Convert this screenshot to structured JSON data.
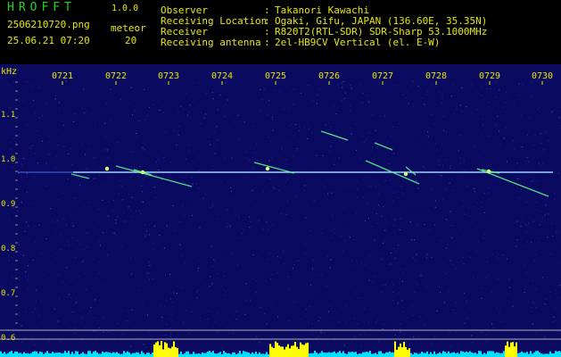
{
  "header": {
    "app_name": "HROFFT",
    "version": "1.0.0",
    "filename": "2506210720.png",
    "timestamp": "25.06.21 07:20",
    "meteor_label": "meteor",
    "meteor_count": "20",
    "info": [
      {
        "label": "Observer",
        "value": "Takanori Kawachi"
      },
      {
        "label": "Receiving Location",
        "value": "Ogaki, Gifu, JAPAN (136.60E, 35.35N)"
      },
      {
        "label": "Receiver",
        "value": "R820T2(RTL-SDR) SDR-Sharp 53.1000MHz"
      },
      {
        "label": "Receiving antenna",
        "value": "2el-HB9CV Vertical (el. E-W)"
      }
    ]
  },
  "axis": {
    "unit": "kHz",
    "time_ticks": [
      "0721",
      "0722",
      "0723",
      "0724",
      "0725",
      "0726",
      "0727",
      "0728",
      "0729",
      "0730"
    ],
    "freq_ticks": [
      "1.1",
      "1.0",
      "0.9",
      "0.8",
      "0.7",
      "0.6"
    ]
  },
  "colors": {
    "background": "#0a0a60",
    "text": "#e8e800",
    "logo": "#1fd61f",
    "carrier": "#9fd0ff",
    "trace": "#60ff90",
    "level_cyan": "#00e0ff",
    "level_yellow": "#ffff00"
  }
}
